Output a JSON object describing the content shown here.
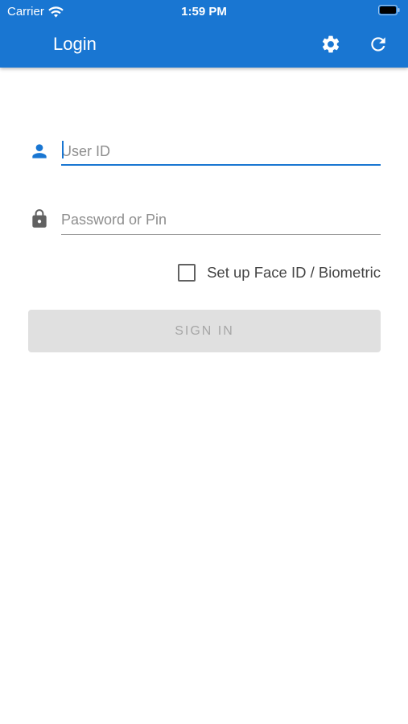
{
  "status_bar": {
    "carrier": "Carrier",
    "time": "1:59 PM",
    "wifi_icon": "wifi-icon",
    "battery_icon": "battery-icon"
  },
  "app_bar": {
    "title": "Login",
    "color": "#1976d2",
    "actions": [
      {
        "name": "settings",
        "icon": "gear-icon"
      },
      {
        "name": "refresh",
        "icon": "refresh-icon"
      }
    ]
  },
  "form": {
    "user_id": {
      "placeholder": "User ID",
      "value": "",
      "icon": "person-icon",
      "focused": true
    },
    "password": {
      "placeholder": "Password or Pin",
      "value": "",
      "icon": "lock-icon"
    },
    "biometric": {
      "label": "Set up Face ID / Biometric",
      "checked": false
    },
    "sign_in": {
      "label": "SIGN IN",
      "enabled": false
    }
  }
}
